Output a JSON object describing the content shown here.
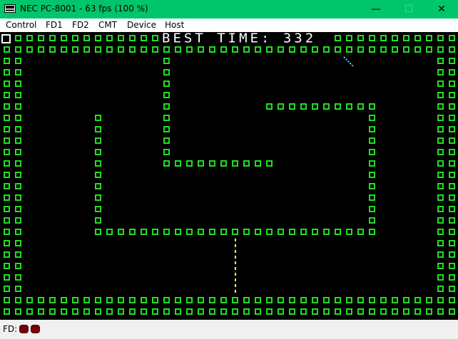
{
  "window": {
    "title": "NEC PC-8001 - 63 fps (100 %)"
  },
  "menu": [
    "Control",
    "FD1",
    "FD2",
    "CMT",
    "Device",
    "Host"
  ],
  "game": {
    "best_time_text": "BEST TIME: 332"
  },
  "status": {
    "label": "FD:",
    "drives": [
      {
        "name": "fd1-indicator",
        "active": true
      },
      {
        "name": "fd2-indicator",
        "active": true
      }
    ]
  },
  "colors": {
    "titlebar": "#00c66b",
    "wall": "#22dd22",
    "screen": "#000000",
    "player1_trail": "#66ddff",
    "player2_trail": "#ffff44",
    "fd_led": "#7a0000"
  }
}
